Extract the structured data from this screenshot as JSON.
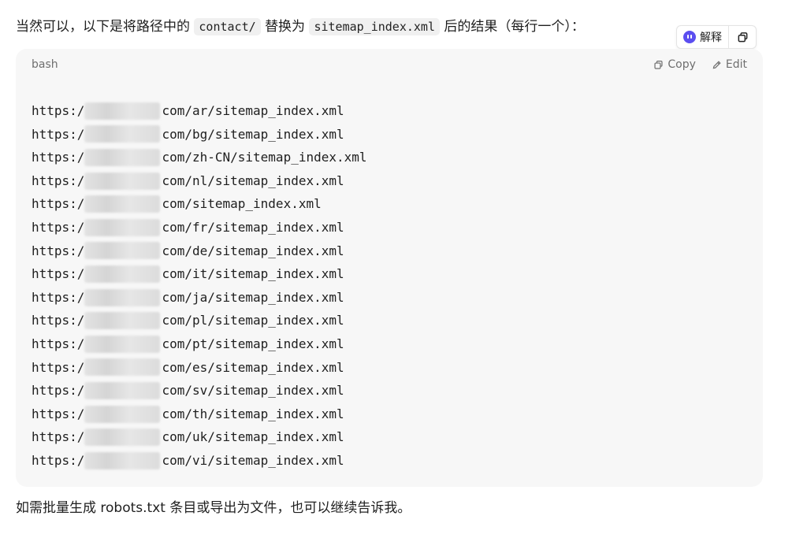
{
  "intro": {
    "before": "当然可以，以下是将路径中的",
    "code_a": "contact/",
    "middle": "替换为",
    "code_b": "sitemap_index.xml",
    "after": "后的结果（每行一个）："
  },
  "tools": {
    "explain_label": "解释",
    "explain_icon": "bot-icon",
    "copy_icon": "copy-icon"
  },
  "code_block": {
    "language": "bash",
    "copy_label": "Copy",
    "edit_label": "Edit",
    "lines": [
      {
        "prefix": "https:/",
        "path": "com/ar/sitemap_index.xml"
      },
      {
        "prefix": "https:/",
        "path": "com/bg/sitemap_index.xml"
      },
      {
        "prefix": "https:/",
        "path": "com/zh-CN/sitemap_index.xml"
      },
      {
        "prefix": "https:/",
        "path": "com/nl/sitemap_index.xml"
      },
      {
        "prefix": "https:/",
        "path": "com/sitemap_index.xml"
      },
      {
        "prefix": "https:/",
        "path": "com/fr/sitemap_index.xml"
      },
      {
        "prefix": "https:/",
        "path": "com/de/sitemap_index.xml"
      },
      {
        "prefix": "https:/",
        "path": "com/it/sitemap_index.xml"
      },
      {
        "prefix": "https:/",
        "path": "com/ja/sitemap_index.xml"
      },
      {
        "prefix": "https:/",
        "path": "com/pl/sitemap_index.xml"
      },
      {
        "prefix": "https:/",
        "path": "com/pt/sitemap_index.xml"
      },
      {
        "prefix": "https:/",
        "path": "com/es/sitemap_index.xml"
      },
      {
        "prefix": "https:/",
        "path": "com/sv/sitemap_index.xml"
      },
      {
        "prefix": "https:/",
        "path": "com/th/sitemap_index.xml"
      },
      {
        "prefix": "https:/",
        "path": "com/uk/sitemap_index.xml"
      },
      {
        "prefix": "https:/",
        "path": "com/vi/sitemap_index.xml"
      }
    ]
  },
  "outro": "如需批量生成 robots.txt 条目或导出为文件，也可以继续告诉我。",
  "colors": {
    "accent": "#5b4ef0",
    "code_bg": "#f7f7f7",
    "muted": "#6f6f6f"
  }
}
